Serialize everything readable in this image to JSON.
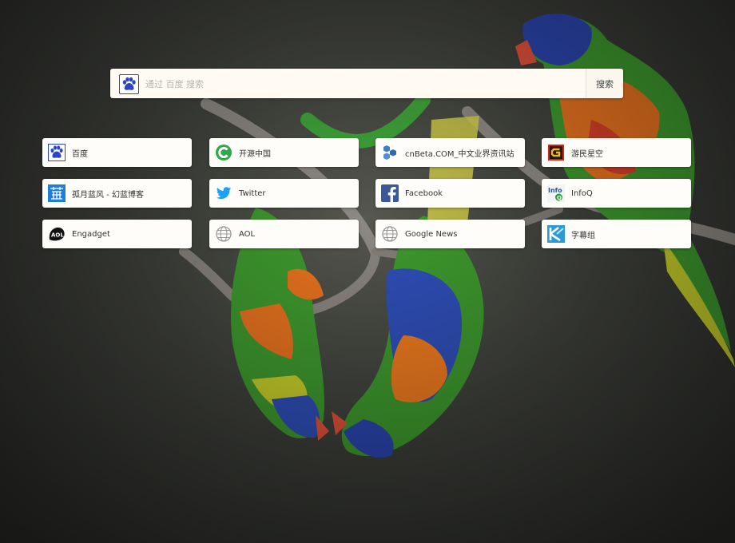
{
  "search": {
    "placeholder": "通过 百度 搜索",
    "button_label": "搜索"
  },
  "tiles": [
    {
      "label": "百度",
      "icon": "baidu-paw-icon"
    },
    {
      "label": "开源中国",
      "icon": "oschina-icon"
    },
    {
      "label": "cnBeta.COM_中文业界资讯站",
      "icon": "cnbeta-icon"
    },
    {
      "label": "游民星空",
      "icon": "gamersky-icon"
    },
    {
      "label": "孤月蓝风 - 幻蓝博客",
      "icon": "lan-blog-icon"
    },
    {
      "label": "Twitter",
      "icon": "twitter-bird-icon"
    },
    {
      "label": "Facebook",
      "icon": "facebook-icon"
    },
    {
      "label": "InfoQ",
      "icon": "infoq-icon"
    },
    {
      "label": "Engadget",
      "icon": "engadget-icon"
    },
    {
      "label": "AOL",
      "icon": "globe-icon"
    },
    {
      "label": "Google News",
      "icon": "globe-icon"
    },
    {
      "label": "字幕组",
      "icon": "zimuzu-icon"
    }
  ],
  "colors": {
    "tile_background": "#fffdfa",
    "baidu_blue": "#2c44c8",
    "twitter_blue": "#1da1f2",
    "facebook_blue": "#3b5998"
  }
}
